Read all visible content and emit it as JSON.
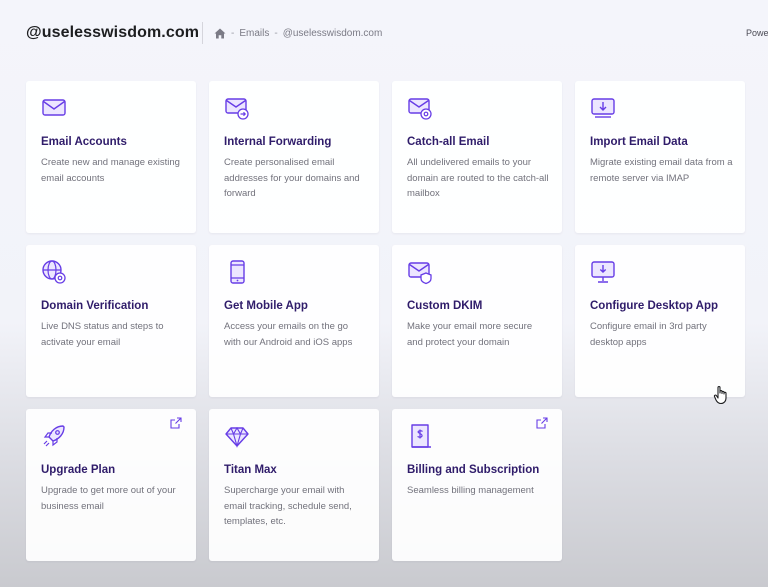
{
  "header": {
    "brand": "@uselesswisdom.com",
    "breadcrumb": {
      "separator": "-",
      "items": [
        "Emails",
        "@uselesswisdom.com"
      ]
    },
    "powered_text": "Powe"
  },
  "colors": {
    "accent": "#673de6",
    "title": "#2f1c6a",
    "description": "#72727c"
  },
  "cards": [
    {
      "icon": "envelope-icon",
      "title": "Email Accounts",
      "description": "Create new and manage existing email accounts",
      "external": false
    },
    {
      "icon": "forward-mail-icon",
      "title": "Internal Forwarding",
      "description": "Create personalised email addresses for your domains and forward",
      "external": false
    },
    {
      "icon": "mail-settings-icon",
      "title": "Catch-all Email",
      "description": "All undelivered emails to your domain are routed to the catch-all mailbox",
      "external": false
    },
    {
      "icon": "import-mail-icon",
      "title": "Import Email Data",
      "description": "Migrate existing email data from a remote server via IMAP",
      "external": false
    },
    {
      "icon": "globe-settings-icon",
      "title": "Domain Verification",
      "description": "Live DNS status and steps to activate your email",
      "external": false
    },
    {
      "icon": "mobile-phone-icon",
      "title": "Get Mobile App",
      "description": "Access your emails on the go with our Android and iOS apps",
      "external": false
    },
    {
      "icon": "mail-shield-icon",
      "title": "Custom DKIM",
      "description": "Make your email more secure and protect your domain",
      "external": false
    },
    {
      "icon": "desktop-download-icon",
      "title": "Configure Desktop App",
      "description": "Configure email in 3rd party desktop apps",
      "external": false
    },
    {
      "icon": "rocket-icon",
      "title": "Upgrade Plan",
      "description": "Upgrade to get more out of your business email",
      "external": true
    },
    {
      "icon": "diamond-icon",
      "title": "Titan Max",
      "description": "Supercharge your email with email tracking, schedule send, templates, etc.",
      "external": false
    },
    {
      "icon": "billing-icon",
      "title": "Billing and Subscription",
      "description": "Seamless billing management",
      "external": true
    }
  ]
}
